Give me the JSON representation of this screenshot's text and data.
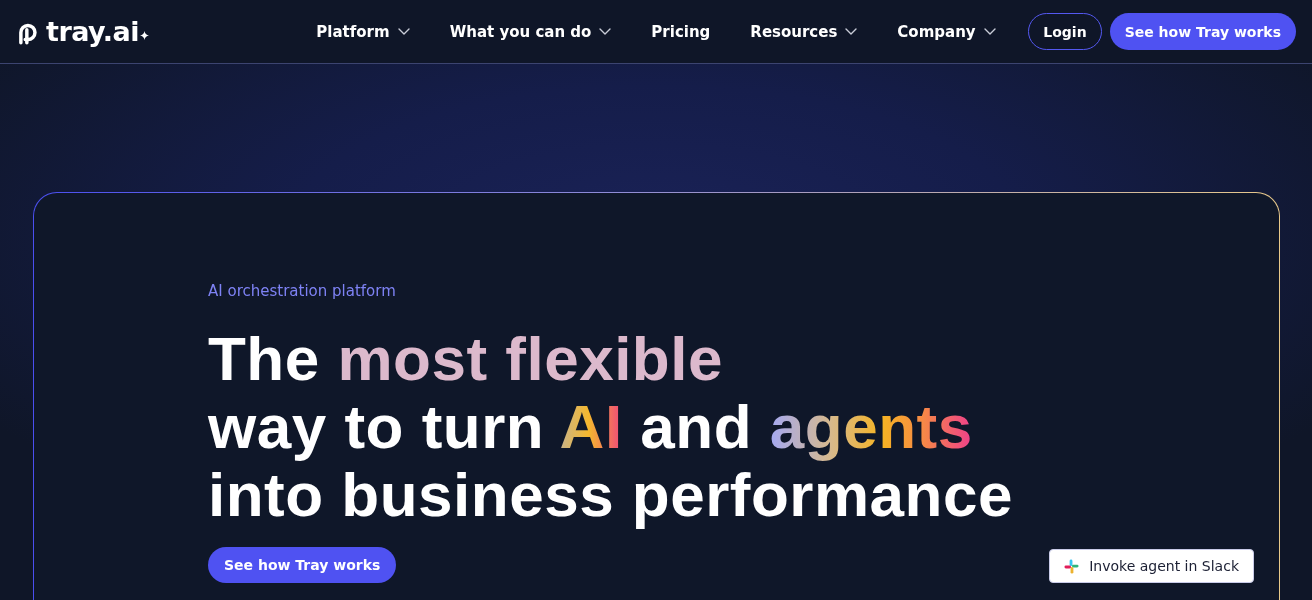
{
  "nav": {
    "logo": "tray.ai",
    "items": [
      {
        "label": "Platform",
        "dropdown": true
      },
      {
        "label": "What you can do",
        "dropdown": true
      },
      {
        "label": "Pricing",
        "dropdown": false
      },
      {
        "label": "Resources",
        "dropdown": true
      },
      {
        "label": "Company",
        "dropdown": true
      }
    ],
    "login": "Login",
    "cta": "See how Tray works"
  },
  "hero": {
    "eyebrow": "AI orchestration platform",
    "headline": [
      [
        {
          "text": "The ",
          "kind": "plain"
        },
        {
          "text": "most flexible",
          "kind": "blush"
        }
      ],
      [
        {
          "text": "way to turn ",
          "kind": "plain"
        },
        {
          "text": "AI",
          "kind": "sunset"
        },
        {
          "text": " and ",
          "kind": "plain"
        },
        {
          "text": "agents",
          "kind": "rainbow"
        }
      ],
      [
        {
          "text": "into business performance",
          "kind": "plain"
        }
      ]
    ],
    "cta": "See how Tray works",
    "chip": {
      "label": "Invoke agent in Slack"
    }
  }
}
